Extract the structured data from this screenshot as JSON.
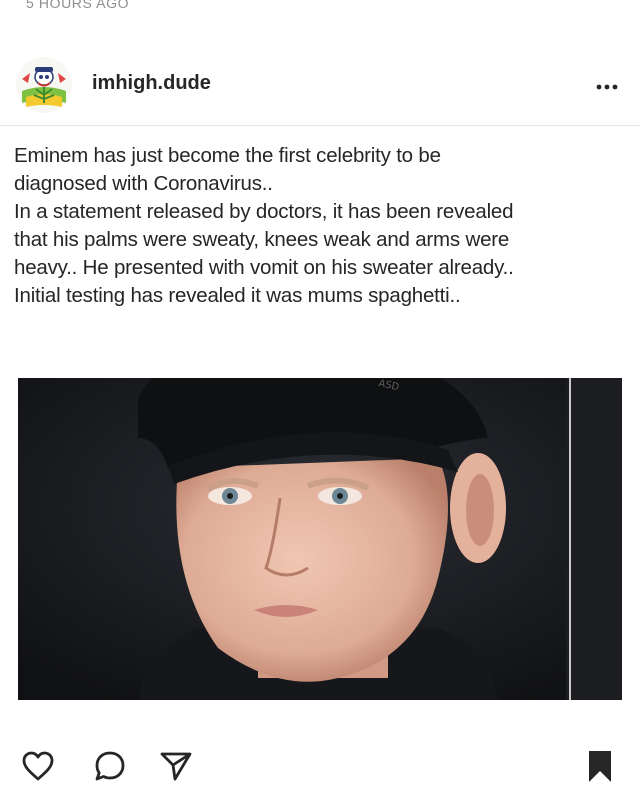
{
  "post": {
    "timestamp": "5 HOURS AGO",
    "username": "imhigh.dude",
    "avatar_icon": "cartoon-character-avatar",
    "caption_lines": [
      "Eminem has just become the first celebrity to be",
      "diagnosed with Coronavirus..",
      "In a statement released by doctors, it has been revealed",
      "that his palms were sweaty, knees weak and arms were",
      "heavy.. He presented with vomit on his sweater already..",
      "Initial testing has revealed it was mums spaghetti.."
    ],
    "image_icon": "portrait-photo-man-in-black-cap"
  },
  "actions": {
    "like_icon": "heart-icon",
    "comment_icon": "comment-icon",
    "share_icon": "share-icon",
    "save_icon": "bookmark-icon"
  },
  "colors": {
    "text": "#262626",
    "muted": "#8e8e8e",
    "border": "#e6e6e6"
  }
}
